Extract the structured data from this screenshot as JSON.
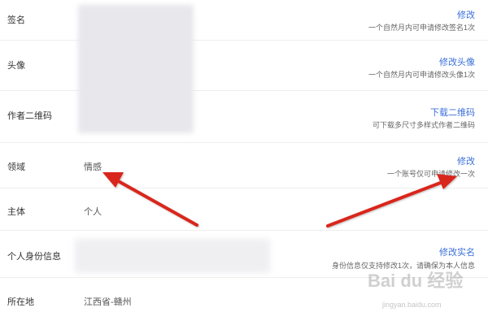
{
  "rows": [
    {
      "label": "签名",
      "action": "修改",
      "note": "一个自然月内可申请修改签名1次"
    },
    {
      "label": "头像",
      "action": "修改头像",
      "note": "一个自然月内可申请修改头像1次"
    },
    {
      "label": "作者二维码",
      "action": "下载二维码",
      "note": "可下载多尺寸多样式作者二维码"
    },
    {
      "label": "领域",
      "value": "情感",
      "action": "修改",
      "note": "一个账号仅可申请修改一次"
    },
    {
      "label": "主体",
      "value": "个人"
    },
    {
      "label": "个人身份信息",
      "action": "修改实名",
      "note": "身份信息仅支持修改1次，请确保为本人信息"
    },
    {
      "label": "所在地",
      "value": "江西省-赣州"
    }
  ],
  "watermark": {
    "logo": "Bai du 经验",
    "url": "jingyan.baidu.com"
  },
  "colors": {
    "link": "#3a6fd8",
    "annotation_arrow": "#d9261c",
    "divider": "#eeeeee"
  }
}
